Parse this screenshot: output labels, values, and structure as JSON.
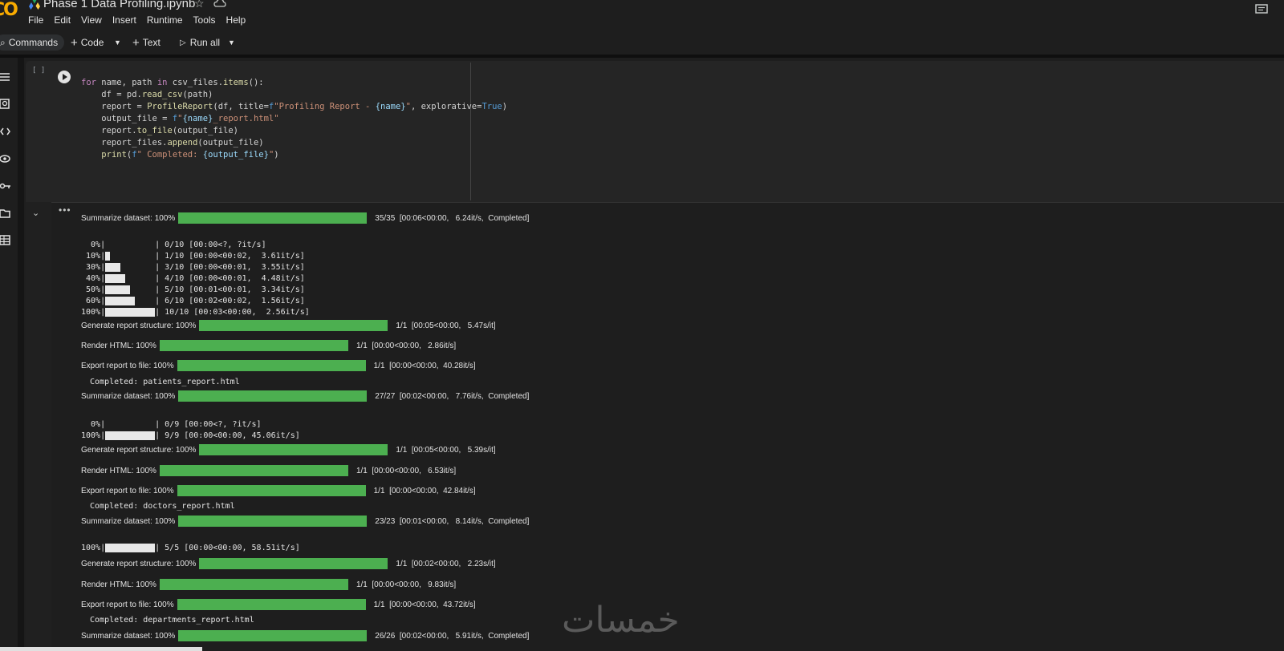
{
  "header": {
    "logo": "CO",
    "title": "Phase 1 Data Profiling.ipynb",
    "menu": [
      "File",
      "Edit",
      "View",
      "Insert",
      "Runtime",
      "Tools",
      "Help"
    ]
  },
  "toolbar": {
    "commands": "Commands",
    "code": "Code",
    "text": "Text",
    "run_all": "Run all"
  },
  "cell": {
    "bracket": "[ ]",
    "code_lines": [
      "for name, path in csv_files.items():",
      "    df = pd.read_csv(path)",
      "    report = ProfileReport(df, title=f\"Profiling Report - {name}\", explorative=True)",
      "    output_file = f\"{name}_report.html\"",
      "    report.to_file(output_file)",
      "    report_files.append(output_file)",
      "    print(f\" Completed: {output_file}\")"
    ]
  },
  "output": {
    "bars": [
      {
        "label": "Summarize dataset: 100%",
        "stats": "35/35  [00:06<00:00,   6.24it/s,  Completed]",
        "progress": 1.0
      },
      {
        "label": "Generate report structure: 100%",
        "stats": "1/1  [00:05<00:00,   5.47s/it]",
        "progress": 1.0
      },
      {
        "label": "Render HTML: 100%",
        "stats": "1/1  [00:00<00:00,   2.86it/s]",
        "progress": 1.0
      },
      {
        "label": "Export report to file: 100%",
        "stats": "1/1  [00:00<00:00,  40.28it/s]",
        "progress": 1.0
      },
      {
        "label": "Summarize dataset: 100%",
        "stats": "27/27  [00:02<00:00,   7.76it/s,  Completed]",
        "progress": 1.0
      },
      {
        "label": "Generate report structure: 100%",
        "stats": "1/1  [00:05<00:00,   5.39s/it]",
        "progress": 1.0
      },
      {
        "label": "Render HTML: 100%",
        "stats": "1/1  [00:00<00:00,   6.53it/s]",
        "progress": 1.0
      },
      {
        "label": "Export report to file: 100%",
        "stats": "1/1  [00:00<00:00,  42.84it/s]",
        "progress": 1.0
      },
      {
        "label": "Summarize dataset: 100%",
        "stats": "23/23  [00:01<00:00,   8.14it/s,  Completed]",
        "progress": 1.0
      },
      {
        "label": "Generate report structure: 100%",
        "stats": "1/1  [00:02<00:00,   2.23s/it]",
        "progress": 1.0
      },
      {
        "label": "Render HTML: 100%",
        "stats": "1/1  [00:00<00:00,   9.83it/s]",
        "progress": 1.0
      },
      {
        "label": "Export report to file: 100%",
        "stats": "1/1  [00:00<00:00,  43.72it/s]",
        "progress": 1.0
      },
      {
        "label": "Summarize dataset: 100%",
        "stats": "26/26  [00:02<00:00,   5.91it/s,  Completed]",
        "progress": 1.0
      }
    ],
    "tqdm_lines": [
      {
        "pct": "  0%",
        "progress": 0.0,
        "stats": "| 0/10 [00:00<?, ?it/s]"
      },
      {
        "pct": " 10%",
        "progress": 0.1,
        "stats": "| 1/10 [00:00<00:02,  3.61it/s]"
      },
      {
        "pct": " 30%",
        "progress": 0.3,
        "stats": "| 3/10 [00:00<00:01,  3.55it/s]"
      },
      {
        "pct": " 40%",
        "progress": 0.4,
        "stats": "| 4/10 [00:00<00:01,  4.48it/s]"
      },
      {
        "pct": " 50%",
        "progress": 0.5,
        "stats": "| 5/10 [00:01<00:01,  3.34it/s]"
      },
      {
        "pct": " 60%",
        "progress": 0.6,
        "stats": "| 6/10 [00:02<00:02,  1.56it/s]"
      },
      {
        "pct": "100%",
        "progress": 1.0,
        "stats": "| 10/10 [00:03<00:00,  2.56it/s]"
      },
      {
        "pct": "  0%",
        "progress": 0.0,
        "stats": "| 0/9 [00:00<?, ?it/s]"
      },
      {
        "pct": "100%",
        "progress": 1.0,
        "stats": "| 9/9 [00:00<00:00, 45.06it/s]"
      },
      {
        "pct": "100%",
        "progress": 1.0,
        "stats": "| 5/5 [00:00<00:00, 58.51it/s]"
      }
    ],
    "completed": [
      " Completed: patients_report.html",
      " Completed: doctors_report.html",
      " Completed: departments_report.html"
    ]
  },
  "watermark": "خمسات",
  "colors": {
    "progress_green": "#4caf50",
    "background": "#1e1e1e"
  }
}
